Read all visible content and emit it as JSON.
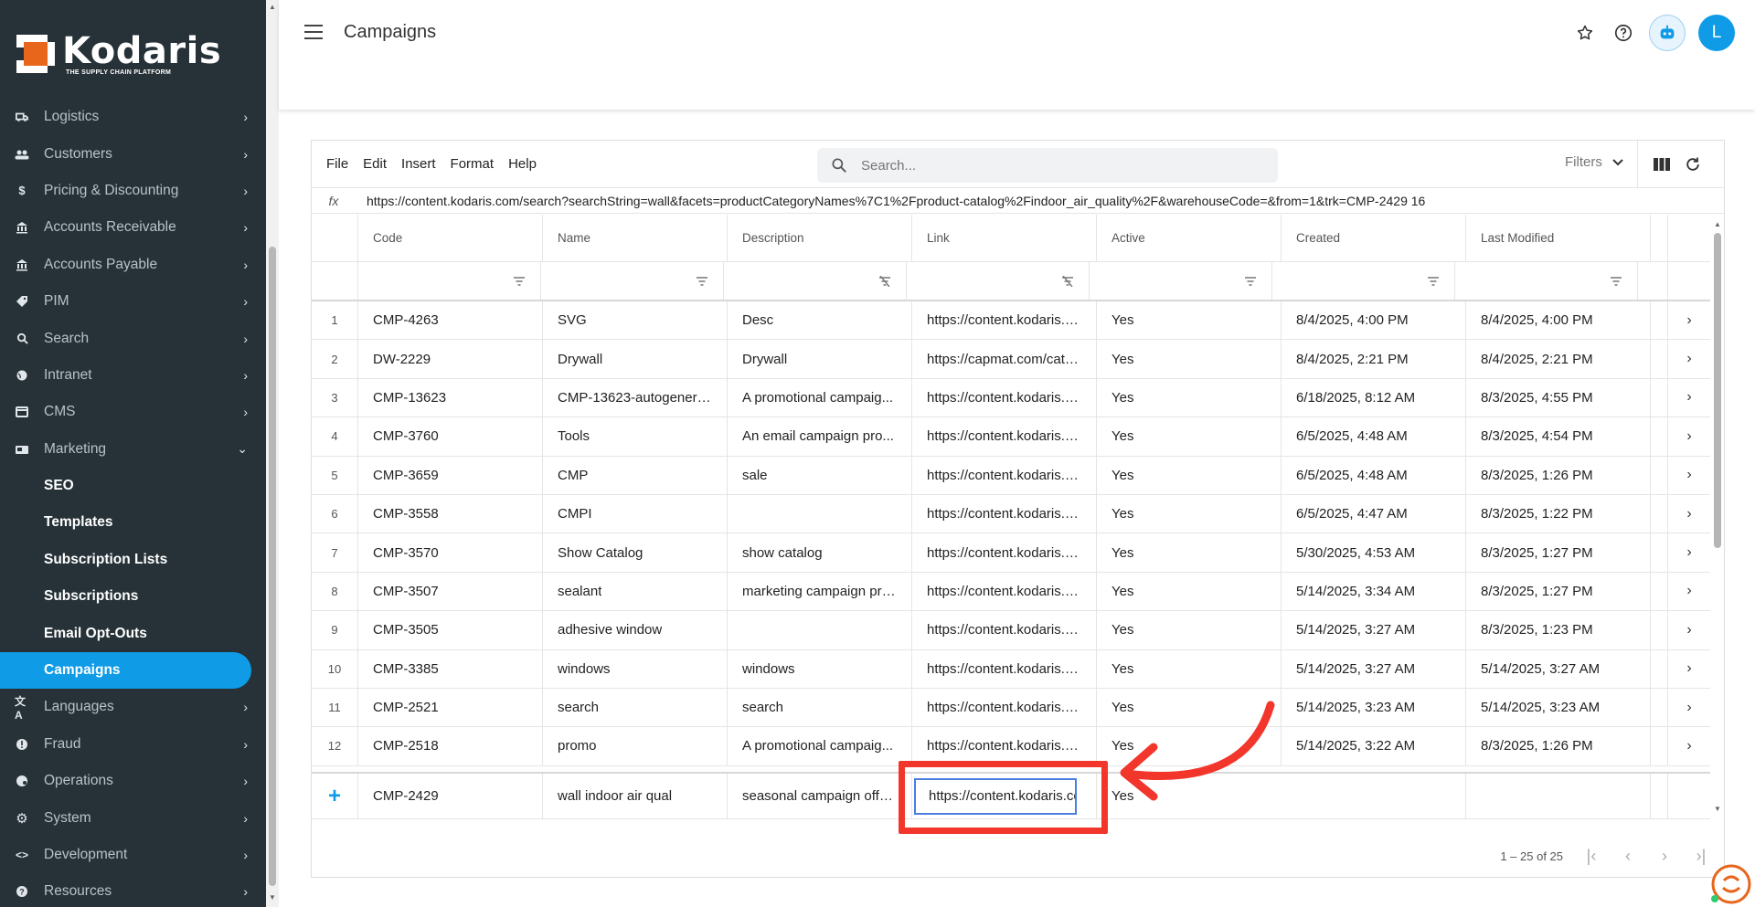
{
  "brand": {
    "name": "Kodaris",
    "tagline": "THE SUPPLY CHAIN PLATFORM",
    "accent": "#0f9be6",
    "logo_orange": "#e8661c"
  },
  "sidebar": {
    "items": [
      {
        "label": "Logistics",
        "icon": "truck-icon"
      },
      {
        "label": "Customers",
        "icon": "people-icon"
      },
      {
        "label": "Pricing & Discounting",
        "icon": "dollar-icon"
      },
      {
        "label": "Accounts Receivable",
        "icon": "bank-icon"
      },
      {
        "label": "Accounts Payable",
        "icon": "bank-icon"
      },
      {
        "label": "PIM",
        "icon": "tag-icon"
      },
      {
        "label": "Search",
        "icon": "search-icon"
      },
      {
        "label": "Intranet",
        "icon": "globe-icon"
      },
      {
        "label": "CMS",
        "icon": "cms-icon"
      },
      {
        "label": "Marketing",
        "icon": "marketing-icon"
      }
    ],
    "marketing_sub": [
      "SEO",
      "Templates",
      "Subscription Lists",
      "Subscriptions",
      "Email Opt-Outs",
      "Campaigns"
    ],
    "active_sub": "Campaigns",
    "items_after": [
      {
        "label": "Languages",
        "icon": "translate-icon"
      },
      {
        "label": "Fraud",
        "icon": "alert-icon"
      },
      {
        "label": "Operations",
        "icon": "palette-icon"
      },
      {
        "label": "System",
        "icon": "gear-icon"
      },
      {
        "label": "Development",
        "icon": "code-icon"
      },
      {
        "label": "Resources",
        "icon": "help-icon"
      }
    ]
  },
  "header": {
    "title": "Campaigns",
    "avatar_initial": "L"
  },
  "toolbar": {
    "menus": [
      "File",
      "Edit",
      "Insert",
      "Format",
      "Help"
    ],
    "search_placeholder": "Search...",
    "filters_label": "Filters"
  },
  "formula": {
    "fx": "fx",
    "value": "https://content.kodaris.com/search?searchString=wall&facets=productCategoryNames%7C1%2Fproduct-catalog%2Findoor_air_quality%2F&warehouseCode=&from=1&trk=CMP-2429 16"
  },
  "columns": [
    "Code",
    "Name",
    "Description",
    "Link",
    "Active",
    "Created",
    "Last Modified"
  ],
  "rows": [
    {
      "n": "1",
      "code": "CMP-4263",
      "name": "SVG",
      "desc": "Desc",
      "link": "https://content.kodaris.c...",
      "active": "Yes",
      "created": "8/4/2025, 4:00 PM",
      "mod": "8/4/2025, 4:00 PM"
    },
    {
      "n": "2",
      "code": "DW-2229",
      "name": "Drywall",
      "desc": "Drywall",
      "link": "https://capmat.com/cate...",
      "active": "Yes",
      "created": "8/4/2025, 2:21 PM",
      "mod": "8/4/2025, 2:21 PM"
    },
    {
      "n": "3",
      "code": "CMP-13623",
      "name": "CMP-13623-autogenera...",
      "desc": "A promotional campaig...",
      "link": "https://content.kodaris.c...",
      "active": "Yes",
      "created": "6/18/2025, 8:12 AM",
      "mod": "8/3/2025, 4:55 PM"
    },
    {
      "n": "4",
      "code": "CMP-3760",
      "name": "Tools",
      "desc": "An email campaign pro...",
      "link": "https://content.kodaris.c...",
      "active": "Yes",
      "created": "6/5/2025, 4:48 AM",
      "mod": "8/3/2025, 4:54 PM"
    },
    {
      "n": "5",
      "code": "CMP-3659",
      "name": "CMP",
      "desc": "sale",
      "link": "https://content.kodaris.c...",
      "active": "Yes",
      "created": "6/5/2025, 4:48 AM",
      "mod": "8/3/2025, 1:26 PM"
    },
    {
      "n": "6",
      "code": "CMP-3558",
      "name": "CMPI",
      "desc": "",
      "link": "https://content.kodaris.c...",
      "active": "Yes",
      "created": "6/5/2025, 4:47 AM",
      "mod": "8/3/2025, 1:22 PM"
    },
    {
      "n": "7",
      "code": "CMP-3570",
      "name": "Show Catalog",
      "desc": "show catalog",
      "link": "https://content.kodaris.c...",
      "active": "Yes",
      "created": "5/30/2025, 4:53 AM",
      "mod": "8/3/2025, 1:27 PM"
    },
    {
      "n": "8",
      "code": "CMP-3507",
      "name": "sealant",
      "desc": "marketing campaign pro...",
      "link": "https://content.kodaris.c...",
      "active": "Yes",
      "created": "5/14/2025, 3:34 AM",
      "mod": "8/3/2025, 1:27 PM"
    },
    {
      "n": "9",
      "code": "CMP-3505",
      "name": "adhesive window",
      "desc": "",
      "link": "https://content.kodaris.c...",
      "active": "Yes",
      "created": "5/14/2025, 3:27 AM",
      "mod": "8/3/2025, 1:23 PM"
    },
    {
      "n": "10",
      "code": "CMP-3385",
      "name": "windows",
      "desc": "windows",
      "link": "https://content.kodaris.c...",
      "active": "Yes",
      "created": "5/14/2025, 3:27 AM",
      "mod": "5/14/2025, 3:27 AM"
    },
    {
      "n": "11",
      "code": "CMP-2521",
      "name": "search",
      "desc": "search",
      "link": "https://content.kodaris.c...",
      "active": "Yes",
      "created": "5/14/2025, 3:23 AM",
      "mod": "5/14/2025, 3:23 AM"
    },
    {
      "n": "12",
      "code": "CMP-2518",
      "name": "promo",
      "desc": "A promotional campaig...",
      "link": "https://content.kodaris.c...",
      "active": "Yes",
      "created": "5/14/2025, 3:22 AM",
      "mod": "8/3/2025, 1:26 PM"
    }
  ],
  "new_row": {
    "code": "CMP-2429",
    "name": "wall indoor air qual",
    "desc": "seasonal campaign offe...",
    "link_value": "https://content.kodaris.com",
    "active": "Yes"
  },
  "pager": {
    "range": "1 – 25 of 25"
  },
  "annotation_color": "#f2362b"
}
